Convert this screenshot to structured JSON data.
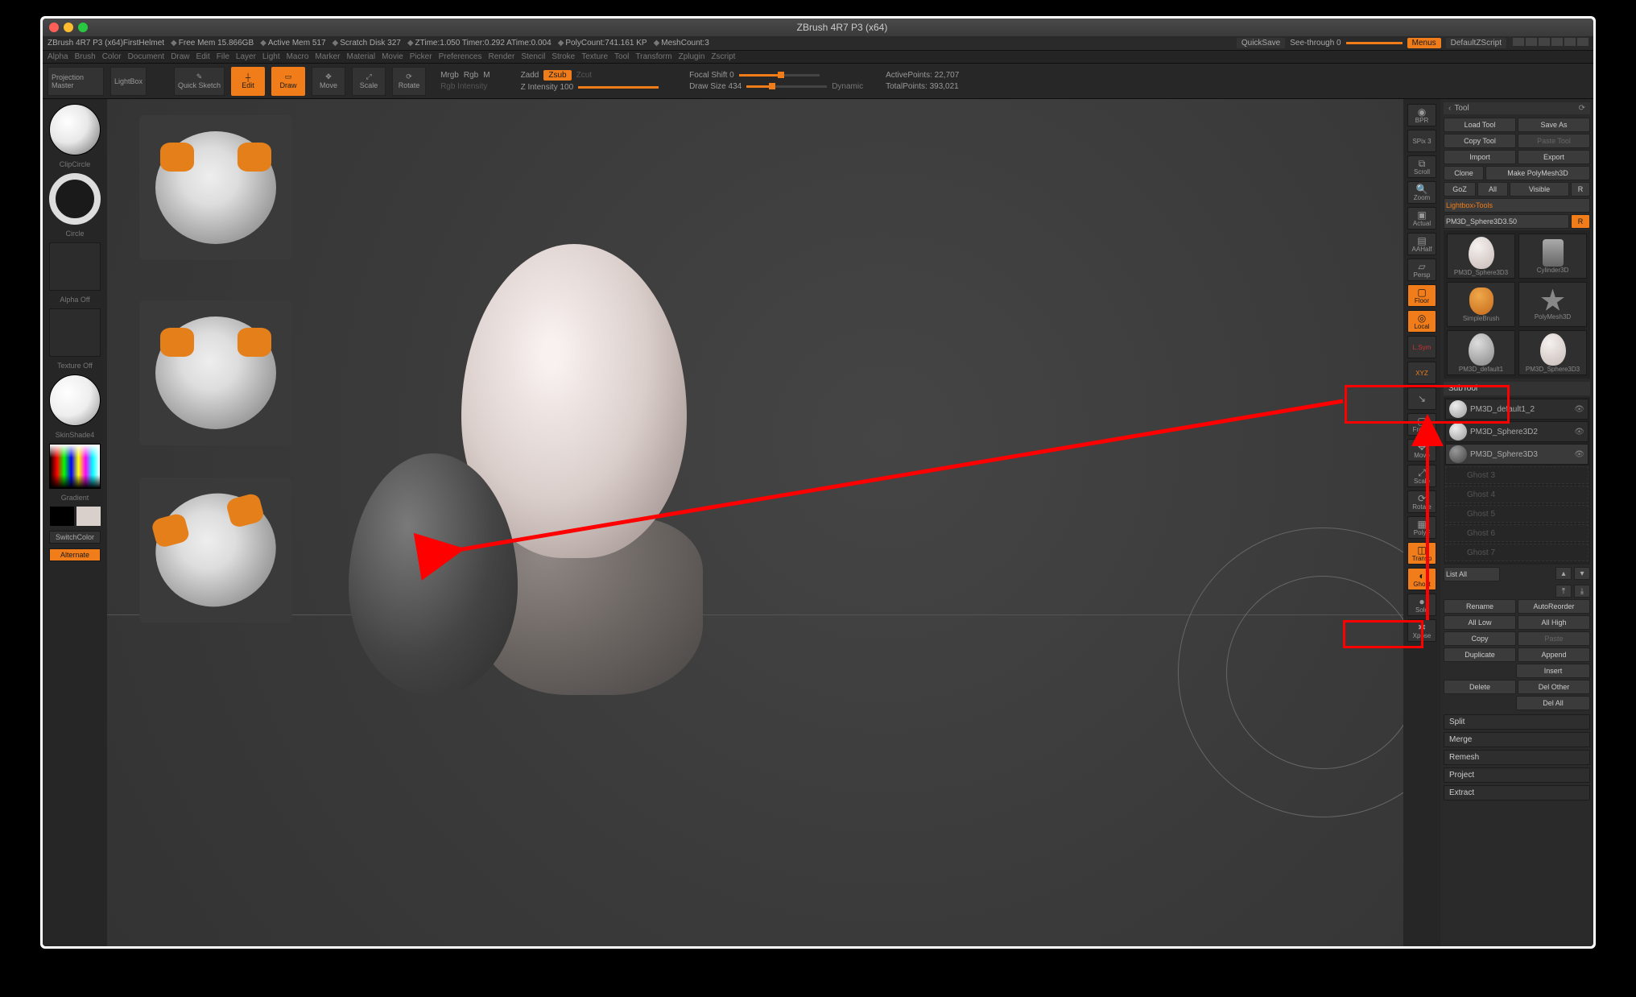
{
  "mac_title": "ZBrush 4R7 P3 (x64)",
  "status": {
    "project": "ZBrush 4R7 P3 (x64)FirstHelmet",
    "free_mem": "Free Mem 15.866GB",
    "active_mem": "Active Mem 517",
    "scratch": "Scratch Disk 327",
    "ztime": "ZTime:1.050 Timer:0.292 ATime:0.004",
    "polycount": "PolyCount:741.161 KP",
    "meshcount": "MeshCount:3",
    "quicksave": "QuickSave",
    "seethrough": "See-through  0",
    "menus": "Menus",
    "zscript": "DefaultZScript"
  },
  "menus": [
    "Alpha",
    "Brush",
    "Color",
    "Document",
    "Draw",
    "Edit",
    "File",
    "Layer",
    "Light",
    "Macro",
    "Marker",
    "Material",
    "Movie",
    "Picker",
    "Preferences",
    "Render",
    "Stencil",
    "Stroke",
    "Texture",
    "Tool",
    "Transform",
    "Zplugin",
    "Zscript"
  ],
  "shelf": {
    "projection": "Projection Master",
    "lightbox": "LightBox",
    "quicksketch": "Quick Sketch",
    "edit": "Edit",
    "draw": "Draw",
    "move": "Move",
    "scale": "Scale",
    "rotate": "Rotate",
    "mrgb": "Mrgb",
    "rgb": "Rgb",
    "m": "M",
    "rgb_int": "Rgb Intensity",
    "zadd": "Zadd",
    "zsub": "Zsub",
    "zcut": "Zcut",
    "zint": "Z Intensity 100",
    "focal": "Focal Shift 0",
    "drawsize": "Draw Size 434",
    "dynamic": "Dynamic",
    "activepts": "ActivePoints: 22,707",
    "totalpts": "TotalPoints: 393,021"
  },
  "left": {
    "clipcircle": "ClipCircle",
    "circle": "Circle",
    "alpha_off": "Alpha Off",
    "texture_off": "Texture Off",
    "skinshade": "SkinShade4",
    "gradient": "Gradient",
    "switch": "SwitchColor",
    "alternate": "Alternate"
  },
  "right": {
    "bpr": "BPR",
    "spix": "SPix 3",
    "scroll": "Scroll",
    "zoom": "Zoom",
    "actual": "Actual",
    "aahalf": "AAHalf",
    "persp": "Persp",
    "floor": "Floor",
    "local": "Local",
    "lsym": "L.Sym",
    "xyz": "XYZ",
    "arrow": "",
    "frame": "Frame",
    "move": "Move",
    "scale": "Scale",
    "rotate": "Rotate",
    "polyf": "PolyF",
    "transp": "Transp",
    "ghost": "Ghost",
    "solo": "Solo",
    "xpose": "Xpose"
  },
  "tool": {
    "title": "Tool",
    "load": "Load Tool",
    "saveas": "Save As",
    "copy": "Copy Tool",
    "paste": "Paste Tool",
    "import": "Import",
    "export": "Export",
    "clone": "Clone",
    "make": "Make PolyMesh3D",
    "goz": "GoZ",
    "all": "All",
    "visible": "Visible",
    "r": "R",
    "lightbox": "Lightbox›Tools",
    "toolname": "PM3D_Sphere3D3.50",
    "thumbs": [
      "PM3D_Sphere3D3",
      "Cylinder3D",
      "SimpleBrush",
      "PolyMesh3D",
      "PM3D_default1",
      "PM3D_Sphere3D3"
    ],
    "subtool_head": "SubTool",
    "subtools": [
      "PM3D_default1_2",
      "PM3D_Sphere3D2",
      "PM3D_Sphere3D3"
    ],
    "ghosts": [
      "Ghost 3",
      "Ghost 4",
      "Ghost 5",
      "Ghost 6",
      "Ghost 7"
    ],
    "listall": "List All",
    "rename": "Rename",
    "autoreorder": "AutoReorder",
    "alllow": "All Low",
    "allhigh": "All High",
    "copy2": "Copy",
    "paste2": "Paste",
    "duplicate": "Duplicate",
    "append": "Append",
    "insert": "Insert",
    "delete": "Delete",
    "delother": "Del Other",
    "delall": "Del All",
    "split": "Split",
    "merge": "Merge",
    "remesh": "Remesh",
    "project": "Project",
    "extract": "Extract"
  }
}
